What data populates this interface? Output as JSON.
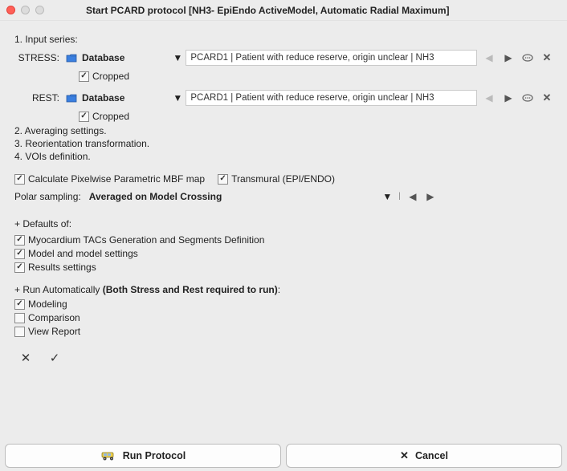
{
  "window": {
    "title": "Start PCARD protocol [NH3- EpiEndo ActiveModel, Automatic Radial Maximum]"
  },
  "section1": {
    "heading": "1. Input series:",
    "stress_label": "STRESS:",
    "rest_label": "REST:",
    "source_name": "Database",
    "value_stress": "PCARD1 | Patient with reduce reserve, origin unclear | NH3",
    "value_rest": "PCARD1 | Patient with reduce reserve, origin unclear | NH3",
    "cropped_label": "Cropped"
  },
  "sections": {
    "s2": "2. Averaging settings.",
    "s3": "3. Reorientation transformation.",
    "s4": "4. VOIs definition."
  },
  "opts": {
    "calc_pixelwise": "Calculate Pixelwise Parametric MBF map",
    "transmural": "Transmural (EPI/ENDO)",
    "polar_label": "Polar sampling:",
    "polar_value": "Averaged on Model Crossing"
  },
  "defaults": {
    "title": "+ Defaults of:",
    "items": [
      "Myocardium TACs Generation and Segments Definition",
      "Model and model settings",
      "Results settings"
    ]
  },
  "runauto": {
    "title_prefix": "+ Run Automatically ",
    "title_bold": "(Both Stress and Rest required to run)",
    "title_suffix": ":",
    "items": [
      {
        "label": "Modeling",
        "checked": true
      },
      {
        "label": "Comparison",
        "checked": false
      },
      {
        "label": "View Report",
        "checked": false
      }
    ]
  },
  "footer": {
    "run": "Run Protocol",
    "cancel": "Cancel"
  }
}
